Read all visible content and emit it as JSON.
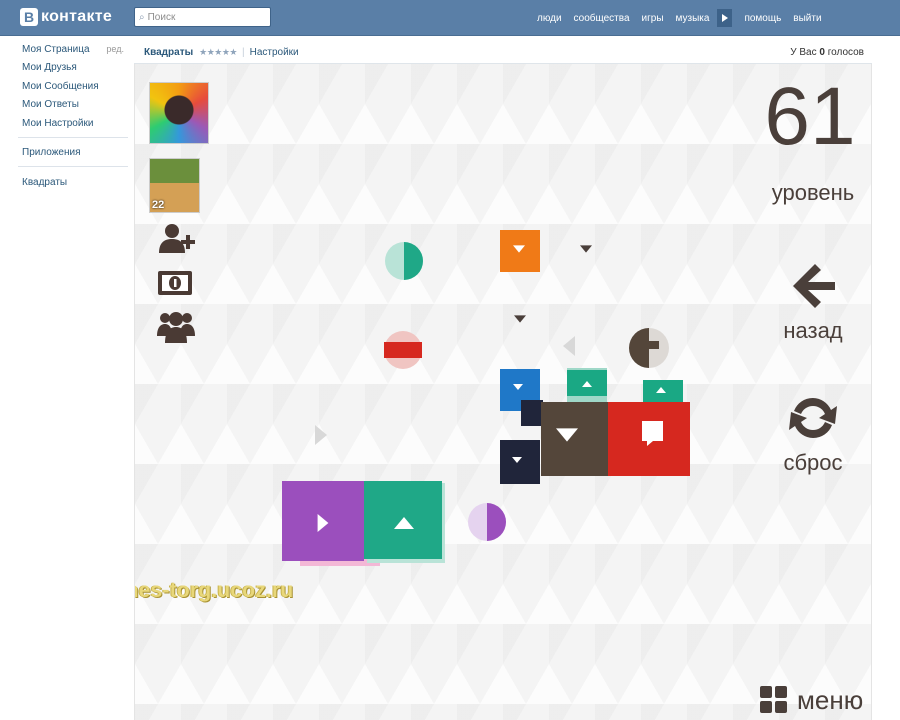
{
  "topbar": {
    "logo_mark": "В",
    "logo_text": "контакте",
    "search_placeholder": "Поиск",
    "nav": [
      "люди",
      "сообщества",
      "игры",
      "музыка"
    ],
    "nav_right": [
      "помощь",
      "выйти"
    ]
  },
  "leftmenu": {
    "items": [
      "Моя Страница",
      "Мои Друзья",
      "Мои Сообщения",
      "Мои Ответы",
      "Мои Настройки"
    ],
    "edit_label": "ред.",
    "apps_label": "Приложения",
    "game_label": "Квадраты"
  },
  "app_header": {
    "title": "Квадраты",
    "stars": "★★★★★",
    "separator": "|",
    "settings": "Настройки",
    "votes_prefix": "У Вас",
    "votes_count": "0",
    "votes_suffix": "голосов"
  },
  "side_tools": {
    "avatar2_badge": "22",
    "icons": [
      "add-friend-icon",
      "money-icon",
      "group-icon"
    ]
  },
  "game": {
    "level_number": "61",
    "level_label": "уровень",
    "back_label": "назад",
    "reset_label": "сброс",
    "menu_label": "меню",
    "watermark": "games-torg.ucoz.ru",
    "colors": {
      "purple": "#9b4fbd",
      "teal": "#1fa887",
      "orange": "#f07a17",
      "blue": "#1f78c8",
      "navy": "#20253a",
      "brown": "#54463a",
      "red": "#d6281f",
      "mint": "#1aa884"
    }
  }
}
